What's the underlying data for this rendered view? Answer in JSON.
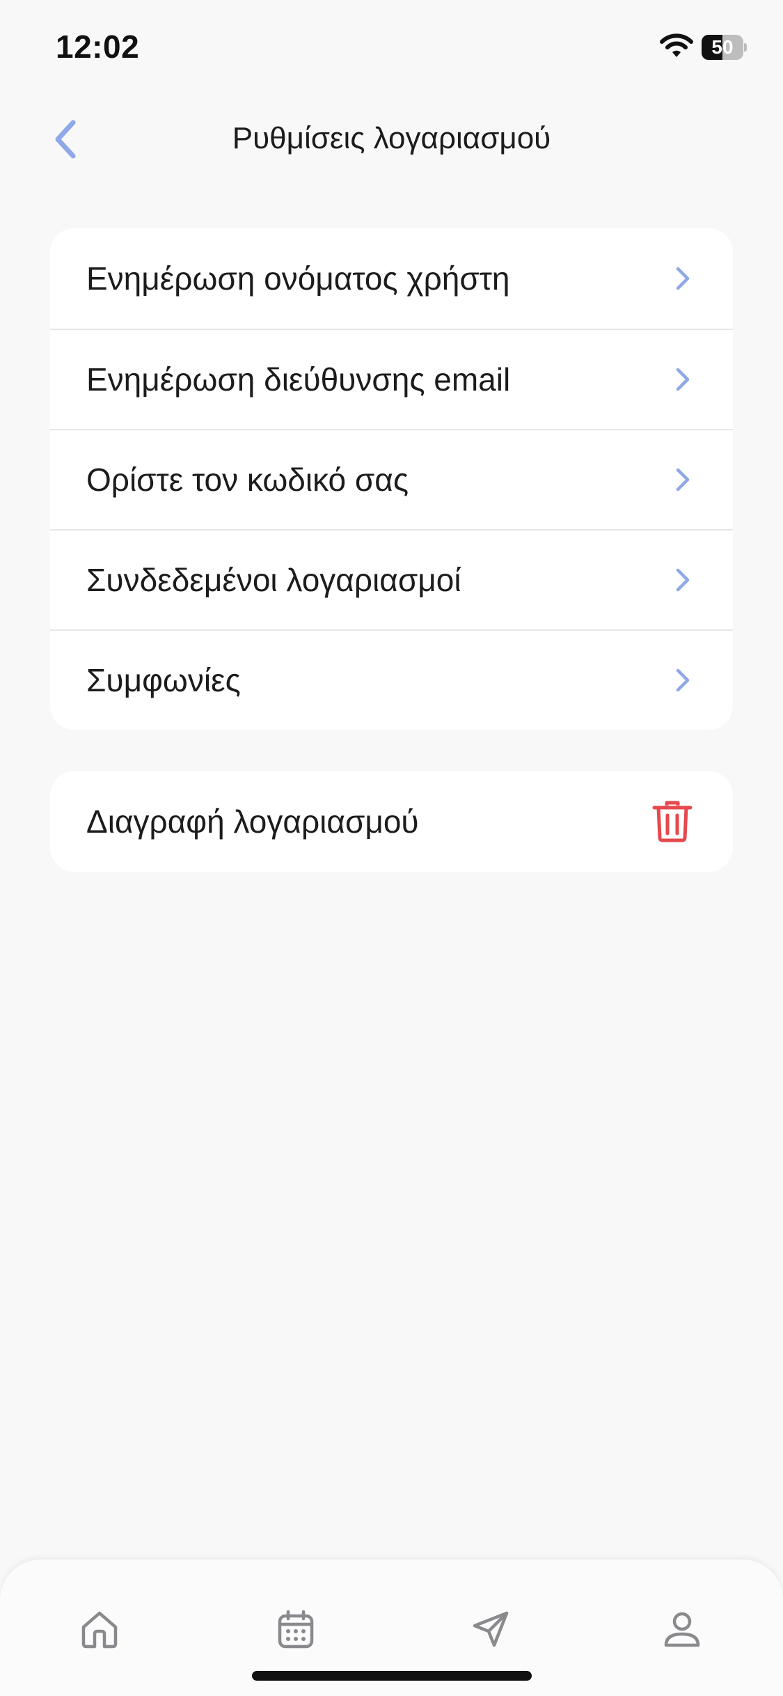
{
  "status_bar": {
    "time": "12:02",
    "battery_percent": "50"
  },
  "header": {
    "title": "Ρυθμίσεις λογαριασμού"
  },
  "settings": {
    "items": [
      {
        "label": "Ενημέρωση ονόματος χρήστη"
      },
      {
        "label": "Ενημέρωση διεύθυνσης email"
      },
      {
        "label": "Ορίστε τον κωδικό σας"
      },
      {
        "label": "Συνδεδεμένοι λογαριασμοί"
      },
      {
        "label": "Συμφωνίες"
      }
    ]
  },
  "danger": {
    "delete_label": "Διαγραφή λογαριασμού"
  },
  "tabbar": {
    "tabs": [
      {
        "icon": "home-icon"
      },
      {
        "icon": "calendar-icon"
      },
      {
        "icon": "send-icon"
      },
      {
        "icon": "profile-icon"
      }
    ]
  },
  "colors": {
    "accent": "#8fa8e8",
    "danger": "#e5484d",
    "background": "#f8f8f8",
    "card": "#ffffff"
  }
}
